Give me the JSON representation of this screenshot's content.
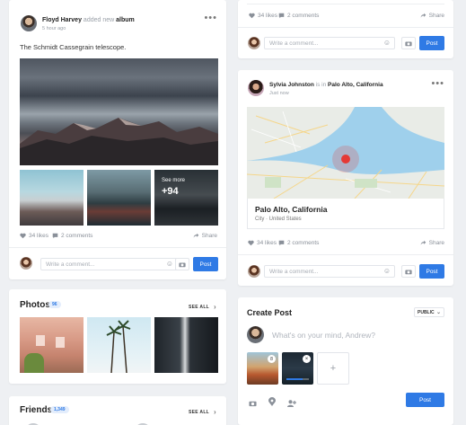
{
  "post1": {
    "author": "Floyd Harvey",
    "action": "added new",
    "object": "album",
    "time": "5 hour ago",
    "caption": "The Schmidt Cassegrain telescope.",
    "see_more": "See more",
    "extra_count": "+94",
    "likes": "34 likes",
    "comments": "2 comments",
    "share": "Share",
    "comment_placeholder": "Write a comment...",
    "post_label": "Post"
  },
  "top_right": {
    "likes": "34 likes",
    "comments": "2 comments",
    "share": "Share",
    "comment_placeholder": "Write a comment...",
    "post_label": "Post"
  },
  "post2": {
    "author": "Sylvia Johnston",
    "is_in": "is in",
    "place": "Palo Alto, California",
    "time": "Just now",
    "map_title": "Palo Alto, California",
    "map_subtitle": "City · United States",
    "likes": "34 likes",
    "comments": "2 comments",
    "share": "Share",
    "comment_placeholder": "Write a comment...",
    "post_label": "Post"
  },
  "photos": {
    "title": "Photos",
    "count": "96",
    "see_all": "SEE ALL"
  },
  "friends": {
    "title": "Friends",
    "count": "1,349",
    "see_all": "SEE ALL"
  },
  "create_post": {
    "title": "Create Post",
    "privacy": "PUBLIC",
    "placeholder": "What's on your mind, Andrew?",
    "thumb_badge": "8",
    "post_label": "Post"
  },
  "colors": {
    "accent": "#2f7ae5",
    "map_water": "#9fd0ec",
    "map_land": "#e9ece7",
    "map_marker": "#e53935"
  },
  "icons": [
    "more-icon",
    "heart-icon",
    "comment-icon",
    "share-icon",
    "smile-icon",
    "camera-icon",
    "chevron-right-icon",
    "chevron-down-icon",
    "location-icon",
    "tag-people-icon",
    "plus-icon",
    "close-icon"
  ]
}
